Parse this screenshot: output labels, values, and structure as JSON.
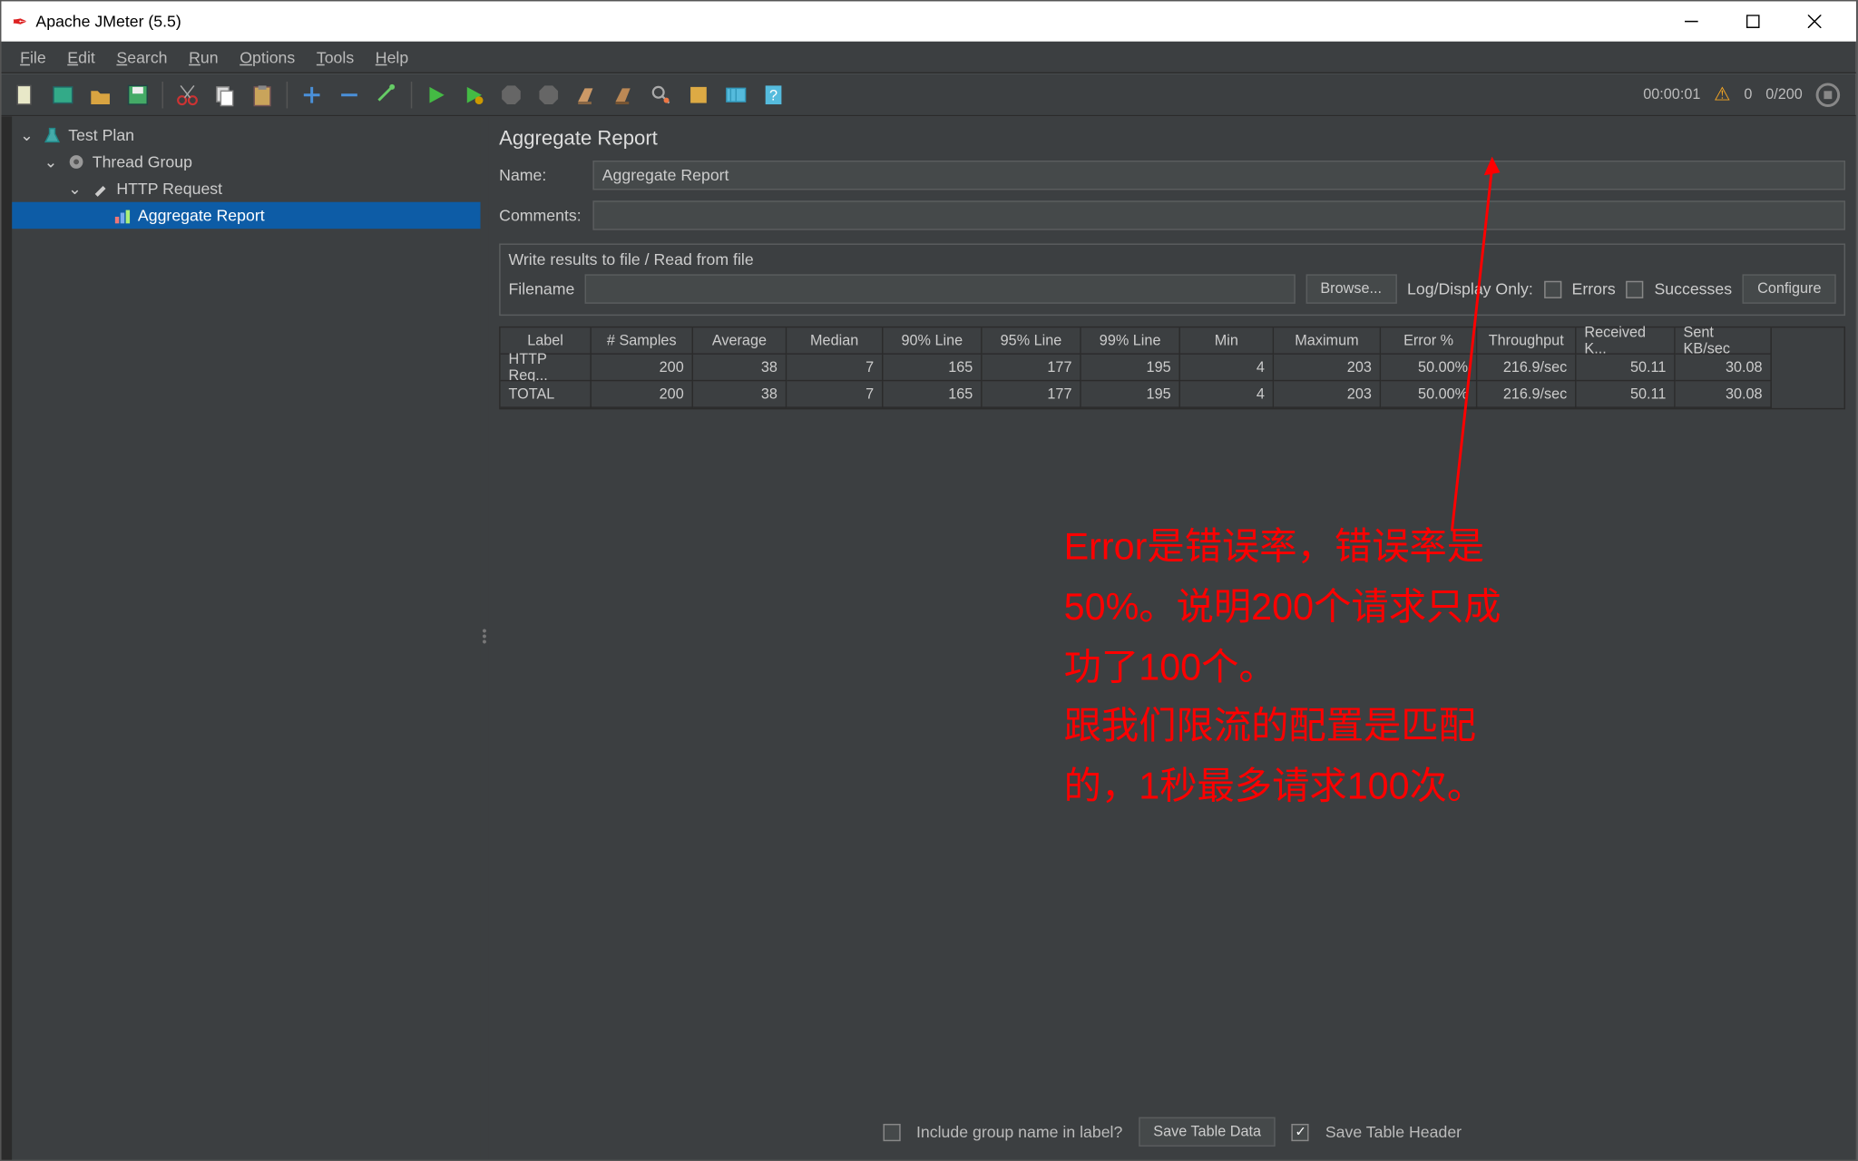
{
  "titlebar": {
    "title": "Apache JMeter (5.5)"
  },
  "menu": {
    "file": "File",
    "edit": "Edit",
    "search": "Search",
    "run": "Run",
    "options": "Options",
    "tools": "Tools",
    "help": "Help"
  },
  "toolbar_status": {
    "time": "00:00:01",
    "warn_count": "0",
    "threads": "0/200"
  },
  "tree": {
    "test_plan": "Test Plan",
    "thread_group": "Thread Group",
    "http_request": "HTTP Request",
    "aggregate_report": "Aggregate Report"
  },
  "panel": {
    "title": "Aggregate Report",
    "name_label": "Name:",
    "name_value": "Aggregate Report",
    "comments_label": "Comments:",
    "fieldset_legend": "Write results to file / Read from file",
    "filename_label": "Filename",
    "browse": "Browse...",
    "logdisplay": "Log/Display Only:",
    "errors": "Errors",
    "successes": "Successes",
    "configure": "Configure"
  },
  "table": {
    "headers": [
      "Label",
      "# Samples",
      "Average",
      "Median",
      "90% Line",
      "95% Line",
      "99% Line",
      "Min",
      "Maximum",
      "Error %",
      "Throughput",
      "Received K...",
      "Sent KB/sec"
    ],
    "rows": [
      {
        "label": "HTTP Req...",
        "samples": "200",
        "avg": "38",
        "median": "7",
        "p90": "165",
        "p95": "177",
        "p99": "195",
        "min": "4",
        "max": "203",
        "err": "50.00%",
        "tp": "216.9/sec",
        "recv": "50.11",
        "sent": "30.08"
      },
      {
        "label": "TOTAL",
        "samples": "200",
        "avg": "38",
        "median": "7",
        "p90": "165",
        "p95": "177",
        "p99": "195",
        "min": "4",
        "max": "203",
        "err": "50.00%",
        "tp": "216.9/sec",
        "recv": "50.11",
        "sent": "30.08"
      }
    ]
  },
  "bottom": {
    "include_group": "Include group name in label?",
    "save_table": "Save Table Data",
    "save_header": "Save Table Header"
  },
  "annotation": {
    "line1": "Error是错误率，错误率是",
    "line2": "50%。说明200个请求只成",
    "line3": "功了100个。",
    "line4": "跟我们限流的配置是匹配",
    "line5": "的，1秒最多请求100次。"
  }
}
